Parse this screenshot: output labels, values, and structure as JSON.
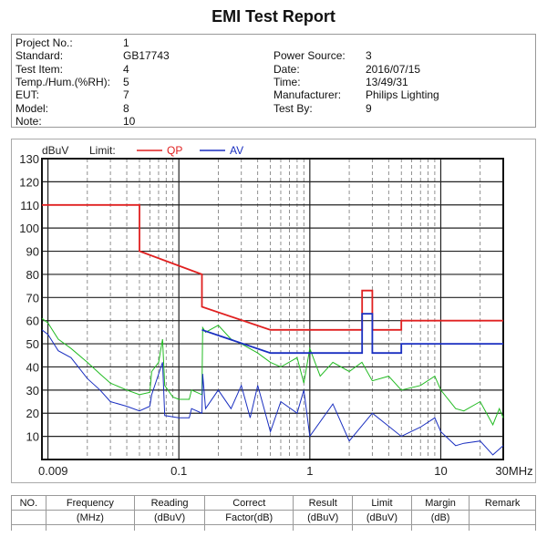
{
  "title": "EMI Test Report",
  "info": {
    "left": [
      [
        "Project No.:",
        "1"
      ],
      [
        "Standard:",
        "GB17743"
      ],
      [
        "Test Item:",
        "4"
      ],
      [
        "Temp./Hum.(%RH):",
        "5"
      ],
      [
        "EUT:",
        "7"
      ],
      [
        "Model:",
        "8"
      ],
      [
        "Note:",
        "10"
      ]
    ],
    "right": [
      [
        "Power Source:",
        "3"
      ],
      [
        "Date:",
        "2016/07/15"
      ],
      [
        "Time:",
        "13/49/31"
      ],
      [
        "Manufacturer:",
        "Philips Lighting"
      ],
      [
        "Test By:",
        "9"
      ]
    ]
  },
  "table": {
    "headers": [
      "NO.",
      "Frequency",
      "Reading",
      "Correct",
      "Result",
      "Limit",
      "Margin",
      "Remark"
    ],
    "units": [
      "",
      "(MHz)",
      "(dBuV)",
      "Factor(dB)",
      "(dBuV)",
      "(dBuV)",
      "(dB)",
      ""
    ]
  },
  "chart_data": {
    "type": "line",
    "ylabel": "dBuV",
    "legend_title": "Limit:",
    "x_scale": "log",
    "xlim": [
      0.009,
      30
    ],
    "ylim": [
      0,
      130
    ],
    "x_ticks": [
      "0.009",
      "0.1",
      "1",
      "10",
      "30MHz"
    ],
    "x_tick_values": [
      0.009,
      0.1,
      1,
      10,
      30
    ],
    "y_ticks": [
      10,
      20,
      30,
      40,
      50,
      60,
      70,
      80,
      90,
      100,
      110,
      120,
      130
    ],
    "grid": true,
    "legend_placement": "top-left",
    "series": [
      {
        "name": "QP",
        "color": "#e02020",
        "role": "limit",
        "points": [
          [
            0.009,
            110
          ],
          [
            0.05,
            110
          ],
          [
            0.05,
            90
          ],
          [
            0.15,
            80
          ],
          [
            0.15,
            66
          ],
          [
            0.5,
            56
          ],
          [
            2.51,
            56
          ],
          [
            2.51,
            73
          ],
          [
            3,
            73
          ],
          [
            3,
            56
          ],
          [
            5,
            56
          ],
          [
            5,
            60
          ],
          [
            30,
            60
          ]
        ]
      },
      {
        "name": "AV",
        "color": "#1a2fc0",
        "role": "limit",
        "points": [
          [
            0.15,
            56
          ],
          [
            0.5,
            46
          ],
          [
            2.51,
            46
          ],
          [
            2.51,
            63
          ],
          [
            3,
            63
          ],
          [
            3,
            46
          ],
          [
            5,
            46
          ],
          [
            5,
            50
          ],
          [
            30,
            50
          ]
        ]
      },
      {
        "color": "#22bb22",
        "role": "measurement",
        "points": [
          [
            0.009,
            61
          ],
          [
            0.01,
            59
          ],
          [
            0.012,
            52
          ],
          [
            0.015,
            48
          ],
          [
            0.02,
            42
          ],
          [
            0.025,
            37
          ],
          [
            0.03,
            33
          ],
          [
            0.04,
            30
          ],
          [
            0.05,
            28
          ],
          [
            0.06,
            29
          ],
          [
            0.062,
            38
          ],
          [
            0.07,
            42
          ],
          [
            0.075,
            52
          ],
          [
            0.078,
            32
          ],
          [
            0.09,
            27
          ],
          [
            0.1,
            26
          ],
          [
            0.12,
            26
          ],
          [
            0.125,
            30
          ],
          [
            0.15,
            28
          ],
          [
            0.152,
            57
          ],
          [
            0.16,
            55
          ],
          [
            0.2,
            58
          ],
          [
            0.25,
            52
          ],
          [
            0.3,
            50
          ],
          [
            0.4,
            46
          ],
          [
            0.5,
            42
          ],
          [
            0.6,
            40
          ],
          [
            0.8,
            44
          ],
          [
            0.9,
            33
          ],
          [
            1,
            48
          ],
          [
            1.2,
            36
          ],
          [
            1.5,
            42
          ],
          [
            2,
            38
          ],
          [
            2.5,
            42
          ],
          [
            3,
            34
          ],
          [
            4,
            36
          ],
          [
            5,
            30
          ],
          [
            7,
            32
          ],
          [
            9,
            36
          ],
          [
            10,
            30
          ],
          [
            13,
            22
          ],
          [
            15,
            21
          ],
          [
            20,
            25
          ],
          [
            25,
            15
          ],
          [
            28,
            22
          ],
          [
            30,
            18
          ]
        ]
      },
      {
        "color": "#1a2fc0",
        "role": "measurement",
        "points": [
          [
            0.009,
            56
          ],
          [
            0.01,
            54
          ],
          [
            0.012,
            47
          ],
          [
            0.015,
            44
          ],
          [
            0.02,
            35
          ],
          [
            0.025,
            30
          ],
          [
            0.03,
            25
          ],
          [
            0.04,
            23
          ],
          [
            0.05,
            21
          ],
          [
            0.06,
            23
          ],
          [
            0.062,
            28
          ],
          [
            0.075,
            42
          ],
          [
            0.078,
            19
          ],
          [
            0.1,
            18
          ],
          [
            0.12,
            18
          ],
          [
            0.125,
            22
          ],
          [
            0.15,
            20
          ],
          [
            0.152,
            37
          ],
          [
            0.16,
            22
          ],
          [
            0.2,
            30
          ],
          [
            0.25,
            22
          ],
          [
            0.3,
            32
          ],
          [
            0.35,
            18
          ],
          [
            0.4,
            32
          ],
          [
            0.5,
            12
          ],
          [
            0.6,
            25
          ],
          [
            0.8,
            20
          ],
          [
            0.9,
            30
          ],
          [
            1,
            10
          ],
          [
            1.5,
            24
          ],
          [
            2,
            8
          ],
          [
            3,
            20
          ],
          [
            5,
            10
          ],
          [
            7,
            14
          ],
          [
            9,
            18
          ],
          [
            10,
            12
          ],
          [
            13,
            6
          ],
          [
            15,
            7
          ],
          [
            20,
            8
          ],
          [
            25,
            2
          ],
          [
            30,
            6
          ]
        ]
      }
    ]
  }
}
